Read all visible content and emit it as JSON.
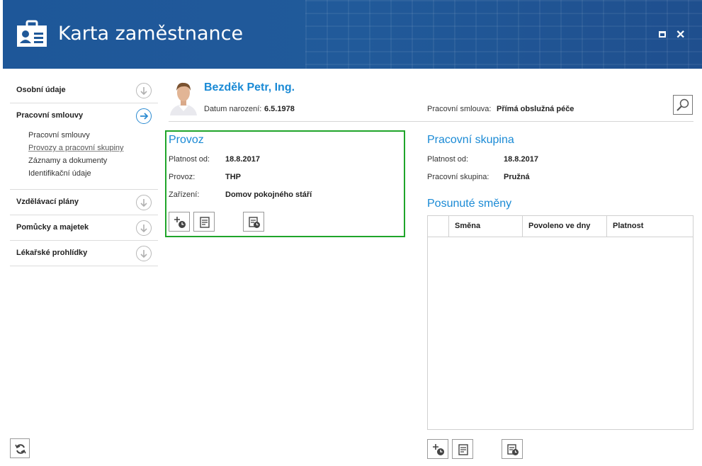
{
  "window": {
    "title": "Karta zaměstnance",
    "header_color": "#1f5898",
    "accent_color": "#1a8ad5",
    "highlight_border_color": "#1fa52a"
  },
  "nav": {
    "items": [
      {
        "label": "Osobní údaje",
        "icon": "arrow-down-icon"
      },
      {
        "label": "Pracovní smlouvy",
        "icon": "arrow-right-icon",
        "active": true
      },
      {
        "label": "Vzdělávací plány",
        "icon": "arrow-down-icon"
      },
      {
        "label": "Pomůcky a majetek",
        "icon": "arrow-down-icon"
      },
      {
        "label": "Lékařské prohlídky",
        "icon": "arrow-down-icon"
      }
    ],
    "subitems": [
      "Pracovní smlouvy",
      "Provozy a pracovní skupiny",
      "Záznamy a dokumenty",
      "Identifikační údaje"
    ]
  },
  "employee": {
    "name": "Bezděk Petr, Ing.",
    "dob_label": "Datum narození:",
    "dob_value": "6.5.1978",
    "contract_label": "Pracovní smlouva:",
    "contract_value": "Přímá obslužná péče"
  },
  "provoz": {
    "title": "Provoz",
    "rows": [
      {
        "label": "Platnost od:",
        "value": "18.8.2017"
      },
      {
        "label": "Provoz:",
        "value": "THP"
      },
      {
        "label": "Zařízení:",
        "value": "Domov pokojného stáří"
      }
    ]
  },
  "skupina": {
    "title": "Pracovní skupina",
    "rows": [
      {
        "label": "Platnost od:",
        "value": "18.8.2017"
      },
      {
        "label": "Pracovní skupina:",
        "value": "Pružná"
      }
    ]
  },
  "smeny": {
    "title": "Posunuté směny",
    "columns": [
      "Směna",
      "Povoleno ve dny",
      "Platnost"
    ],
    "rows": []
  }
}
